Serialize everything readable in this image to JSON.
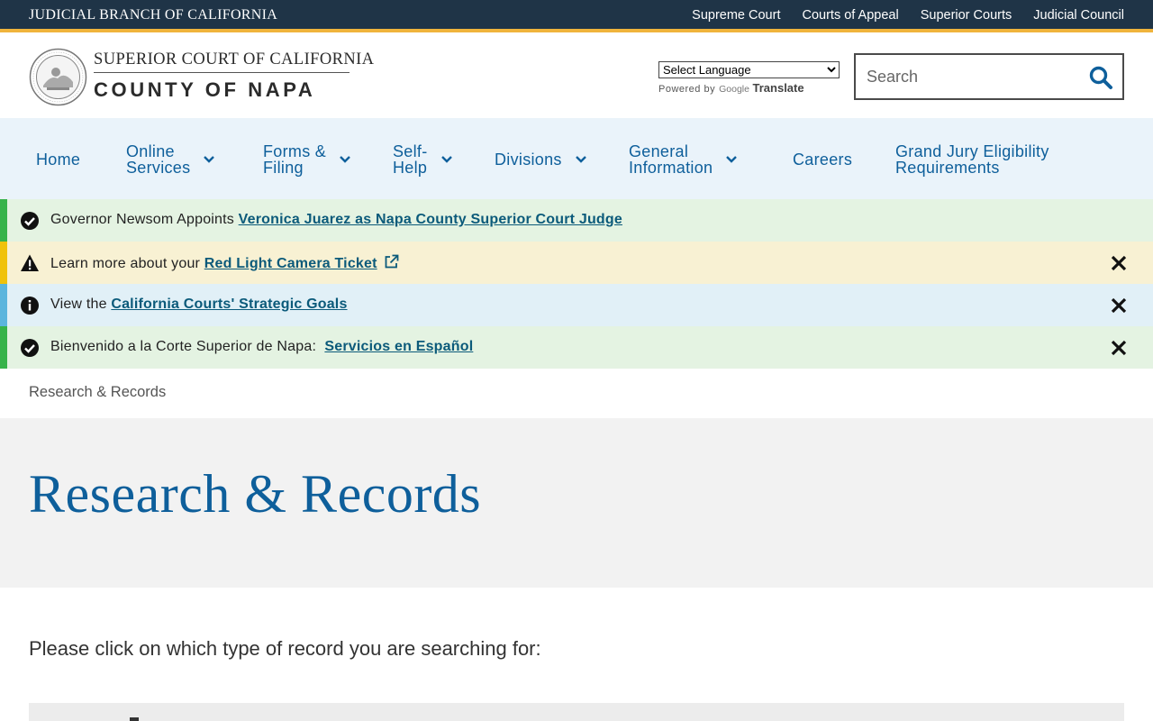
{
  "topbar": {
    "brand": "JUDICIAL BRANCH OF CALIFORNIA",
    "links": [
      "Supreme Court",
      "Courts of Appeal",
      "Superior Courts",
      "Judicial Council"
    ]
  },
  "header": {
    "logo_line1": "SUPERIOR COURT OF CALIFORNIA",
    "logo_line2": "COUNTY OF NAPA",
    "language_select": "Select Language",
    "powered_by": "Powered by",
    "google": "Google",
    "translate": "Translate",
    "search_placeholder": "Search"
  },
  "nav": {
    "items": [
      {
        "label": "Home",
        "has_menu": false
      },
      {
        "label": "Online\nServices",
        "has_menu": true
      },
      {
        "label": "Forms &\nFiling",
        "has_menu": true
      },
      {
        "label": "Self-\nHelp",
        "has_menu": true
      },
      {
        "label": "Divisions",
        "has_menu": true
      },
      {
        "label": "General\nInformation",
        "has_menu": true
      },
      {
        "label": "Careers",
        "has_menu": false
      },
      {
        "label": "Grand Jury Eligibility\nRequirements",
        "has_menu": false
      }
    ]
  },
  "alerts": [
    {
      "type": "success",
      "prefix": "Governor Newsom Appoints ",
      "link": "Veronica Juarez as Napa County Superior Court Judge",
      "closable": false
    },
    {
      "type": "warning",
      "prefix": "Learn more about your ",
      "link": "Red Light Camera Ticket",
      "external": true,
      "closable": true
    },
    {
      "type": "info",
      "prefix": "View the ",
      "link": "California Courts' Strategic Goals",
      "closable": true
    },
    {
      "type": "success",
      "prefix": "Bienvenido a la Corte Superior de Napa:  ",
      "link": "Servicios en Español",
      "closable": true
    }
  ],
  "breadcrumb": "Research & Records",
  "page_title": "Research & Records",
  "intro": "Please click on which type of record you are searching for:",
  "colors": {
    "topbar": "#1f3447",
    "gold": "#f0b43c",
    "primary": "#0e5f9b",
    "nav_bg": "#eaf3fa"
  }
}
